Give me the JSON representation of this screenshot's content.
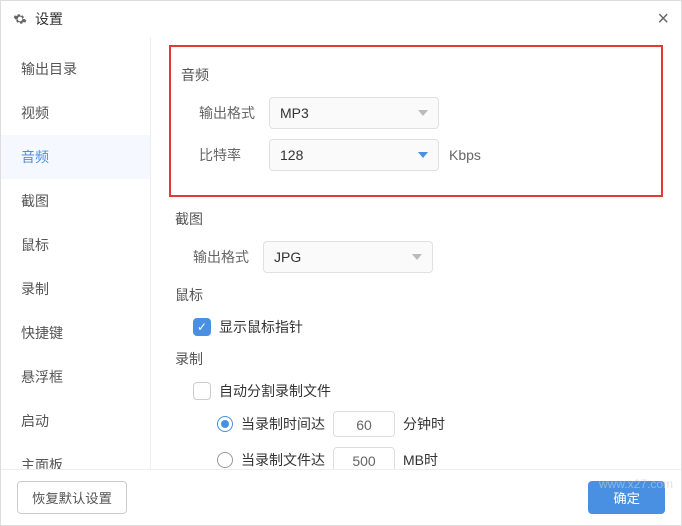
{
  "title": "设置",
  "sidebar": {
    "items": [
      {
        "label": "输出目录"
      },
      {
        "label": "视频"
      },
      {
        "label": "音频"
      },
      {
        "label": "截图"
      },
      {
        "label": "鼠标"
      },
      {
        "label": "录制"
      },
      {
        "label": "快捷键"
      },
      {
        "label": "悬浮框"
      },
      {
        "label": "启动"
      },
      {
        "label": "主面板"
      }
    ],
    "active_index": 2
  },
  "sections": {
    "audio": {
      "title": "音频",
      "format_label": "输出格式",
      "format_value": "MP3",
      "bitrate_label": "比特率",
      "bitrate_value": "128",
      "bitrate_unit": "Kbps"
    },
    "screenshot": {
      "title": "截图",
      "format_label": "输出格式",
      "format_value": "JPG"
    },
    "mouse": {
      "title": "鼠标",
      "show_pointer_label": "显示鼠标指针",
      "show_pointer_checked": true
    },
    "record": {
      "title": "录制",
      "auto_split_label": "自动分割录制文件",
      "auto_split_checked": false,
      "by_time_label_prefix": "当录制时间达",
      "by_time_value": "60",
      "by_time_unit": "分钟时",
      "by_time_selected": true,
      "by_size_label_prefix": "当录制文件达",
      "by_size_value": "500",
      "by_size_unit": "MB时",
      "by_size_selected": false
    }
  },
  "footer": {
    "restore_defaults": "恢复默认设置",
    "ok": "确定"
  },
  "watermark": "www.x27.com"
}
